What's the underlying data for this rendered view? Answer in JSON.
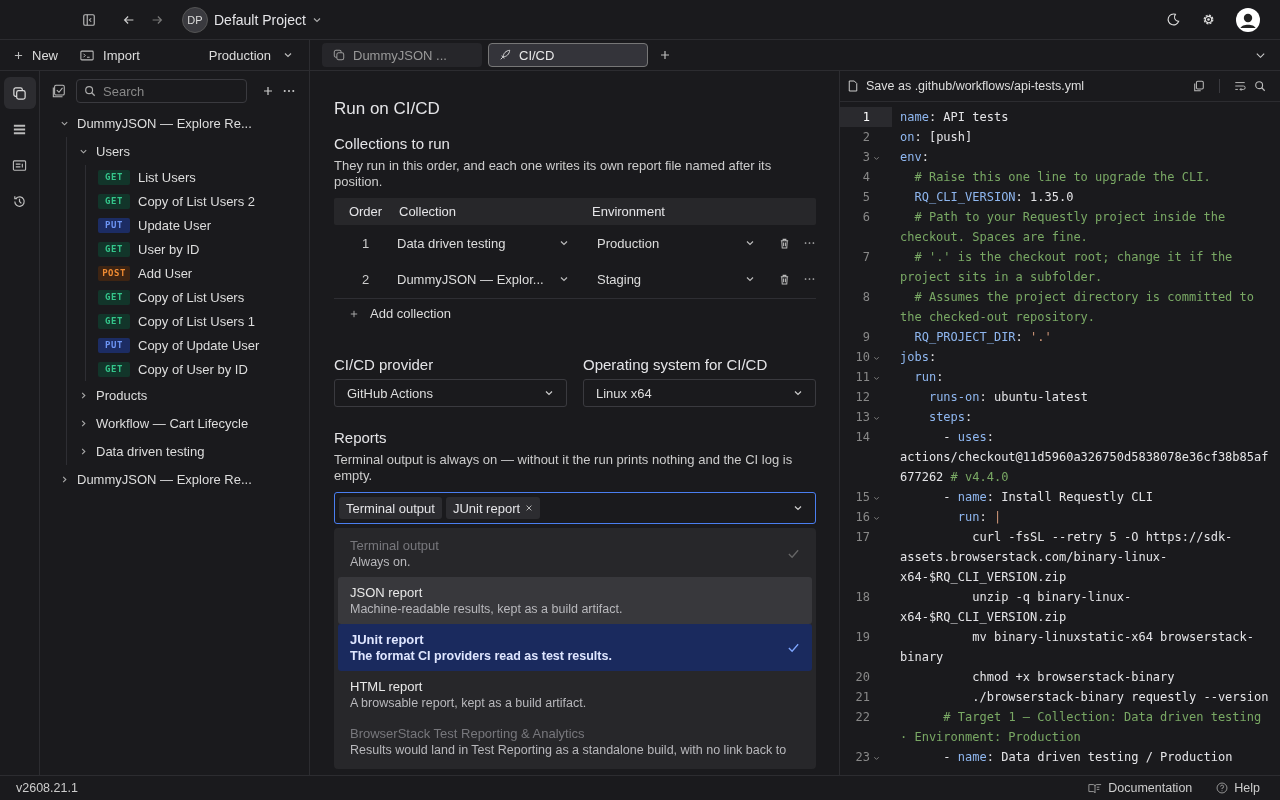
{
  "top_bar": {
    "project": {
      "initials": "DP",
      "name": "Default Project"
    }
  },
  "sidebar_toolbar": {
    "new_label": "New",
    "import_label": "Import",
    "environment": "Production"
  },
  "rail": [
    {
      "kind": "collections",
      "selected": true
    },
    {
      "kind": "list",
      "selected": false
    },
    {
      "kind": "environments",
      "selected": false
    },
    {
      "kind": "history",
      "selected": false
    }
  ],
  "search": {
    "placeholder": "Search"
  },
  "tree": [
    {
      "kind": "collection",
      "label": "DummyJSON — Explore Re...",
      "expanded": true,
      "children": [
        {
          "kind": "folder",
          "label": "Users",
          "expanded": true,
          "children": [
            {
              "kind": "request",
              "method": "GET",
              "label": "List Users"
            },
            {
              "kind": "request",
              "method": "GET",
              "label": "Copy of List Users 2"
            },
            {
              "kind": "request",
              "method": "PUT",
              "label": "Update User"
            },
            {
              "kind": "request",
              "method": "GET",
              "label": "User by ID"
            },
            {
              "kind": "request",
              "method": "POST",
              "label": "Add User"
            },
            {
              "kind": "request",
              "method": "GET",
              "label": "Copy of List Users"
            },
            {
              "kind": "request",
              "method": "GET",
              "label": "Copy of List Users 1"
            },
            {
              "kind": "request",
              "method": "PUT",
              "label": "Copy of Update User"
            },
            {
              "kind": "request",
              "method": "GET",
              "label": "Copy of User by ID"
            }
          ]
        },
        {
          "kind": "folder",
          "label": "Products",
          "expanded": false
        },
        {
          "kind": "folder",
          "label": "Workflow — Cart Lifecycle",
          "expanded": false
        },
        {
          "kind": "folder",
          "label": "Data driven testing",
          "expanded": false
        }
      ]
    },
    {
      "kind": "collection",
      "label": "DummyJSON — Explore Re...",
      "expanded": false
    }
  ],
  "tabs": [
    {
      "kind": "collection",
      "label": "DummyJSON ...",
      "selected": false
    },
    {
      "kind": "rocket",
      "label": "CI/CD",
      "selected": true
    }
  ],
  "page": {
    "title": "Run on CI/CD",
    "collections": {
      "heading": "Collections to run",
      "description": "They run in this order, and each one writes its own report file named after its position.",
      "columns": [
        "Order",
        "Collection",
        "Environment"
      ],
      "rows": [
        {
          "order": "1",
          "collection": "Data driven testing",
          "environment": "Production"
        },
        {
          "order": "2",
          "collection": "DummyJSON — Explor...",
          "environment": "Staging"
        }
      ],
      "add_label": "Add collection"
    },
    "provider": {
      "label": "CI/CD provider",
      "value": "GitHub Actions"
    },
    "os": {
      "label": "Operating system for CI/CD",
      "value": "Linux x64"
    },
    "reports": {
      "heading": "Reports",
      "description": "Terminal output is always on — without it the run prints nothing and the CI log is empty.",
      "chips": [
        {
          "label": "Terminal output",
          "removable": false
        },
        {
          "label": "JUnit report",
          "removable": true
        }
      ],
      "options": [
        {
          "title": "Terminal output",
          "description": "Always on.",
          "disabled": true,
          "selected": true,
          "hovered": false
        },
        {
          "title": "JSON report",
          "description": "Machine-readable results, kept as a build artifact.",
          "disabled": false,
          "selected": false,
          "hovered": true
        },
        {
          "title": "JUnit report",
          "description": "The format CI providers read as test results.",
          "disabled": false,
          "selected": true,
          "hovered": false
        },
        {
          "title": "HTML report",
          "description": "A browsable report, kept as a build artifact.",
          "disabled": false,
          "selected": false,
          "hovered": false
        },
        {
          "title": "BrowserStack Test Reporting & Analytics",
          "description": "Results would land in Test Reporting as a standalone build, with no link back to",
          "disabled": true,
          "selected": false,
          "hovered": false
        }
      ]
    }
  },
  "editor": {
    "file_label": "Save as .github/workflows/api-tests.yml",
    "lines": [
      {
        "num": "1",
        "fold": false,
        "active": true,
        "parts": [
          {
            "kind": "key",
            "text": "name"
          },
          {
            "kind": "plain",
            "text": ": API tests"
          }
        ]
      },
      {
        "num": "2",
        "fold": false,
        "active": false,
        "parts": [
          {
            "kind": "key",
            "text": "on"
          },
          {
            "kind": "plain",
            "text": ": [push]"
          }
        ]
      },
      {
        "num": "3",
        "fold": true,
        "active": false,
        "parts": [
          {
            "kind": "key",
            "text": "env"
          },
          {
            "kind": "plain",
            "text": ":"
          }
        ]
      },
      {
        "num": "4",
        "fold": false,
        "active": false,
        "parts": [
          {
            "kind": "comment",
            "text": "  # Raise this one line to upgrade the CLI."
          }
        ]
      },
      {
        "num": "5",
        "fold": false,
        "active": false,
        "parts": [
          {
            "kind": "key",
            "text": "  RQ_CLI_VERSION"
          },
          {
            "kind": "plain",
            "text": ": 1.35.0"
          }
        ]
      },
      {
        "num": "6",
        "fold": false,
        "active": false,
        "parts": [
          {
            "kind": "comment",
            "text": "  # Path to your Requestly project inside the checkout. Spaces are fine."
          }
        ]
      },
      {
        "num": "7",
        "fold": false,
        "active": false,
        "parts": [
          {
            "kind": "comment",
            "text": "  # '.' is the checkout root; change it if the project sits in a subfolder."
          }
        ]
      },
      {
        "num": "8",
        "fold": false,
        "active": false,
        "parts": [
          {
            "kind": "comment",
            "text": "  # Assumes the project directory is committed to the checked-out repository."
          }
        ]
      },
      {
        "num": "9",
        "fold": false,
        "active": false,
        "parts": [
          {
            "kind": "key",
            "text": "  RQ_PROJECT_DIR"
          },
          {
            "kind": "plain",
            "text": ": "
          },
          {
            "kind": "string",
            "text": "'.'"
          }
        ]
      },
      {
        "num": "10",
        "fold": true,
        "active": false,
        "parts": [
          {
            "kind": "key",
            "text": "jobs"
          },
          {
            "kind": "plain",
            "text": ":"
          }
        ]
      },
      {
        "num": "11",
        "fold": true,
        "active": false,
        "parts": [
          {
            "kind": "key",
            "text": "  run"
          },
          {
            "kind": "plain",
            "text": ":"
          }
        ]
      },
      {
        "num": "12",
        "fold": false,
        "active": false,
        "parts": [
          {
            "kind": "key",
            "text": "    runs-on"
          },
          {
            "kind": "plain",
            "text": ": ubuntu-latest"
          }
        ]
      },
      {
        "num": "13",
        "fold": true,
        "active": false,
        "parts": [
          {
            "kind": "key",
            "text": "    steps"
          },
          {
            "kind": "plain",
            "text": ":"
          }
        ]
      },
      {
        "num": "14",
        "fold": false,
        "active": false,
        "parts": [
          {
            "kind": "plain",
            "text": "      - "
          },
          {
            "kind": "key",
            "text": "uses"
          },
          {
            "kind": "plain",
            "text": ": actions/checkout@11d5960a326750d5838078e36cf38b85af677262 "
          },
          {
            "kind": "comment",
            "text": "# v4.4.0"
          }
        ]
      },
      {
        "num": "15",
        "fold": true,
        "active": false,
        "parts": [
          {
            "kind": "plain",
            "text": "      - "
          },
          {
            "kind": "key",
            "text": "name"
          },
          {
            "kind": "plain",
            "text": ": Install Requestly CLI"
          }
        ]
      },
      {
        "num": "16",
        "fold": true,
        "active": false,
        "parts": [
          {
            "kind": "key",
            "text": "        run"
          },
          {
            "kind": "plain",
            "text": ": "
          },
          {
            "kind": "string",
            "text": "|"
          }
        ]
      },
      {
        "num": "17",
        "fold": false,
        "active": false,
        "parts": [
          {
            "kind": "plain",
            "text": "          curl -fsSL --retry 5 -O https://sdk-assets.browserstack.com/binary-linux-x64-$RQ_CLI_VERSION.zip"
          }
        ]
      },
      {
        "num": "18",
        "fold": false,
        "active": false,
        "parts": [
          {
            "kind": "plain",
            "text": "          unzip -q binary-linux-x64-$RQ_CLI_VERSION.zip"
          }
        ]
      },
      {
        "num": "19",
        "fold": false,
        "active": false,
        "parts": [
          {
            "kind": "plain",
            "text": "          mv binary-linuxstatic-x64 browserstack-binary"
          }
        ]
      },
      {
        "num": "20",
        "fold": false,
        "active": false,
        "parts": [
          {
            "kind": "plain",
            "text": "          chmod +x browserstack-binary"
          }
        ]
      },
      {
        "num": "21",
        "fold": false,
        "active": false,
        "parts": [
          {
            "kind": "plain",
            "text": "          ./browserstack-binary requestly --version"
          }
        ]
      },
      {
        "num": "22",
        "fold": false,
        "active": false,
        "parts": [
          {
            "kind": "comment",
            "text": "      # Target 1 — Collection: Data driven testing · Environment: Production"
          }
        ]
      },
      {
        "num": "23",
        "fold": true,
        "active": false,
        "parts": [
          {
            "kind": "plain",
            "text": "      - "
          },
          {
            "kind": "key",
            "text": "name"
          },
          {
            "kind": "plain",
            "text": ": Data driven testing / Production"
          }
        ]
      }
    ]
  },
  "status_bar": {
    "version": "v2608.21.1",
    "documentation": "Documentation",
    "help": "Help"
  }
}
